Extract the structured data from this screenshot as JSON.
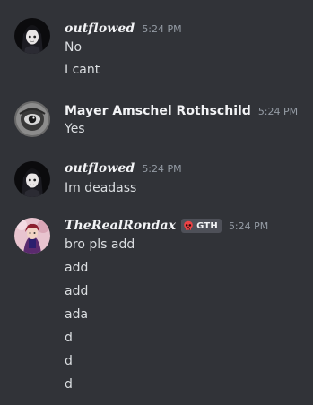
{
  "messages": [
    {
      "username": "outflowed",
      "timestamp": "5:24 PM",
      "avatar_icon": "anime-girl-avatar-icon",
      "lines": [
        "No",
        "I cant"
      ]
    },
    {
      "username": "Mayer Amschel Rothschild",
      "timestamp": "5:24 PM",
      "avatar_icon": "grayscale-photo-avatar-icon",
      "lines": [
        "Yes"
      ]
    },
    {
      "username": "outflowed",
      "timestamp": "5:24 PM",
      "avatar_icon": "anime-girl-avatar-icon",
      "lines": [
        "Im deadass"
      ]
    },
    {
      "username": "TheRealRondax",
      "timestamp": "5:24 PM",
      "avatar_icon": "anime-character-avatar-icon",
      "tag": {
        "icon": "skull-icon",
        "label": "GTH"
      },
      "lines": [
        "bro pls add",
        "add",
        "add",
        "ada",
        "d",
        "d",
        "d"
      ]
    }
  ],
  "colors": {
    "background": "#313338",
    "username": "#f2f3f5",
    "message_text": "#dbdee1",
    "timestamp": "#949ba4",
    "tag_background": "#4e5058",
    "skull": "#ed4245"
  }
}
